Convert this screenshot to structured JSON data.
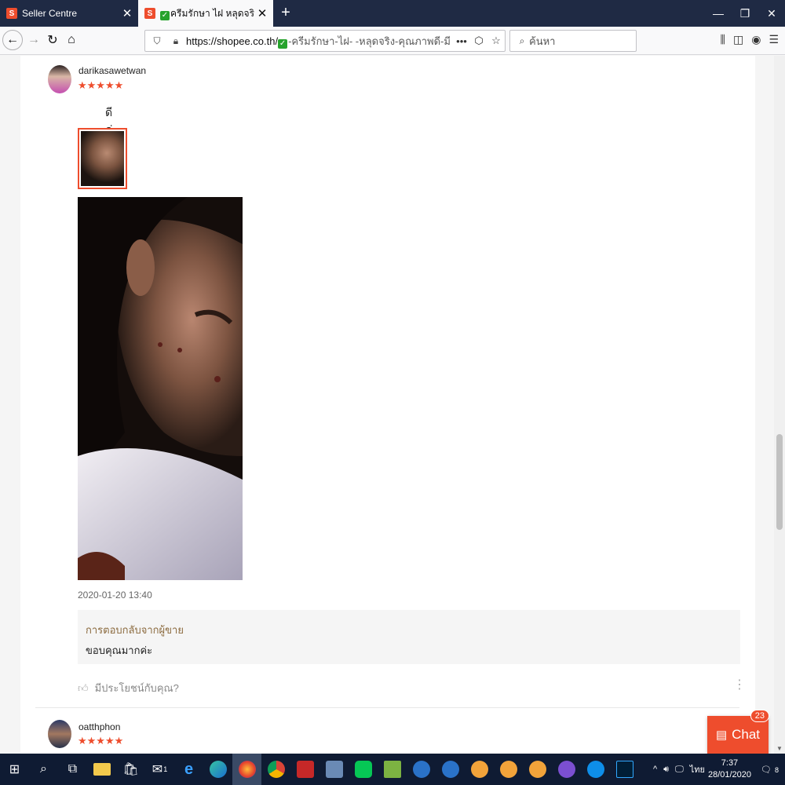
{
  "browser": {
    "tabs": [
      {
        "title": "Seller Centre",
        "active": false
      },
      {
        "title": "ครีมรักษา ไฝ หลุดจริง คุณ",
        "active": true
      }
    ],
    "url_host": "https://shopee.co.th/",
    "url_path": "-ครีมรักษา-ไฝ-  -หลุดจริง-คุณภาพดี-มี",
    "search_placeholder": "ค้นหา"
  },
  "reviews": [
    {
      "username": "darikasawetwan",
      "stars": "★★★★★",
      "comment": "ดีค่ะ",
      "timestamp": "2020-01-20 13:40",
      "reply_label": "การตอบกลับจากผู้ขาย",
      "reply_text": "ขอบคุณมากค่ะ",
      "helpful_text": "มีประโยชน์กับคุณ?"
    },
    {
      "username": "oatthphon",
      "stars": "★★★★★"
    }
  ],
  "chat": {
    "label": "Chat",
    "badge": "23"
  },
  "taskbar": {
    "tray_lang": "ไทย",
    "time": "7:37",
    "date": "28/01/2020",
    "notif_count": "8",
    "mail_count": "1"
  },
  "colors": {
    "accent": "#ee4d2d",
    "star": "#ee4d2d",
    "reply_label": "#8b6a3e"
  }
}
